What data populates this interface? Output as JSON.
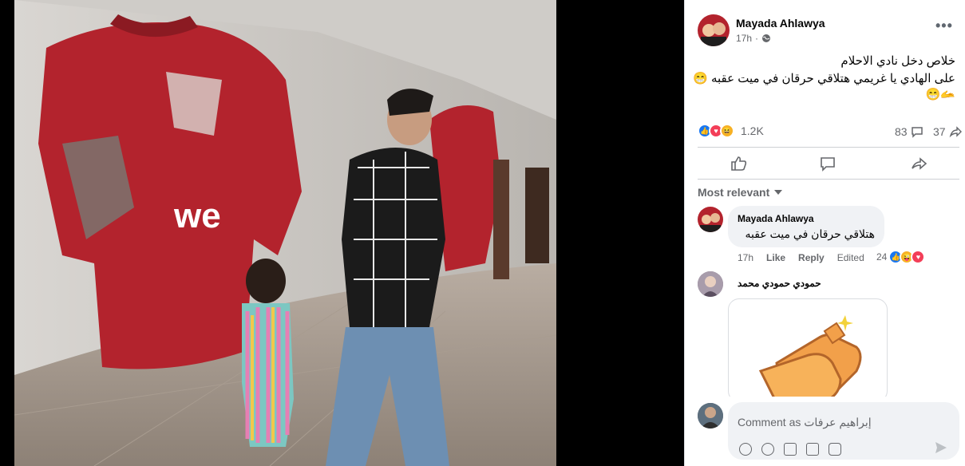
{
  "post": {
    "author": "Mayada Ahlawya",
    "time": "17h",
    "privacy_icon": "globe-icon",
    "text_line1": "خلاص دخل نادي الاحلام",
    "text_line2": "على الهادي يا غريمي هتلاقي حرقان في ميت عقبه",
    "text_emoji1": "😁",
    "text_emoji2": "🫴😁",
    "reaction_count": "1.2K",
    "comment_count": "83",
    "share_count": "37"
  },
  "sort": {
    "label": "Most relevant"
  },
  "comments": [
    {
      "author": "Mayada Ahlawya",
      "text": "هتلاقي حرقان في ميت عقبه",
      "time": "17h",
      "like": "Like",
      "reply": "Reply",
      "edited": "Edited",
      "reaction_count": "24"
    },
    {
      "author": "حمودي حمودي محمد",
      "sticker": "clapping-hands-sticker"
    }
  ],
  "composer": {
    "placeholder": "Comment as إبراهيم عرفات"
  },
  "colors": {
    "like_blue": "#1877f2",
    "love_red": "#f33e58",
    "haha_yellow": "#f7b125",
    "jersey_red": "#b3232d"
  }
}
